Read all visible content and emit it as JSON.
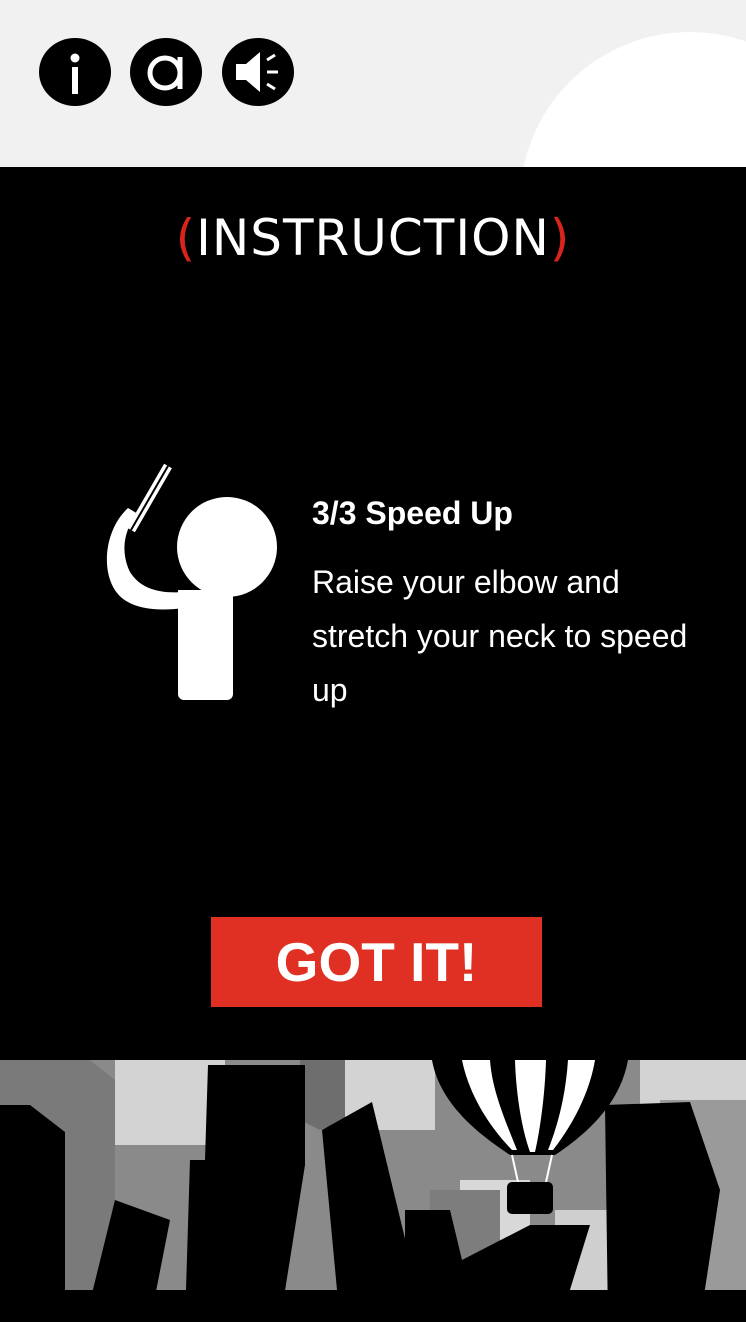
{
  "toolbar": {
    "info_icon": "info-icon",
    "about_icon": "letter-a-icon",
    "sound_icon": "speaker-icon"
  },
  "instruction": {
    "paren_open": "(",
    "title": "INSTRUCTION",
    "paren_close": ")",
    "step_heading": "3/3 Speed Up",
    "step_body": "Raise your elbow and stretch your neck to speed up"
  },
  "button": {
    "label": "GOT IT!"
  },
  "colors": {
    "accent_red": "#e03024",
    "top_bar": "#f1f1f1",
    "panel": "#000000"
  }
}
